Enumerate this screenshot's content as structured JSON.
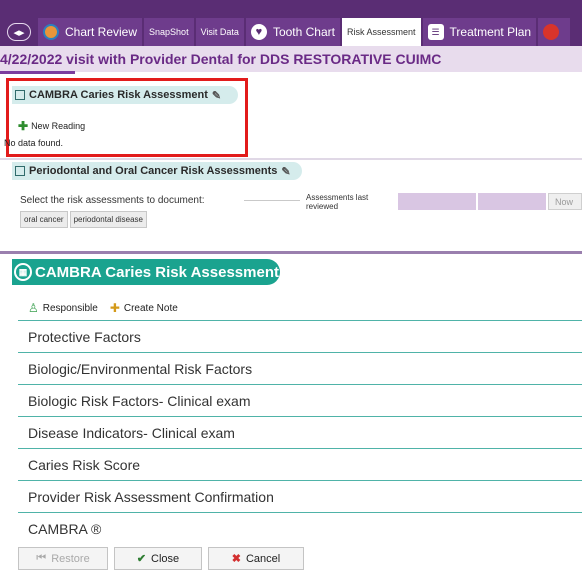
{
  "tabs": [
    {
      "label": "Chart Review",
      "icon": "chart-review-icon"
    },
    {
      "label": "SnapShot"
    },
    {
      "label": "Visit Data"
    },
    {
      "label": "Tooth Chart",
      "icon": "tooth-icon"
    },
    {
      "label": "Risk Assessment",
      "active": true
    },
    {
      "label": "Treatment Plan",
      "icon": "treatment-plan-icon"
    }
  ],
  "banner": {
    "title": "4/22/2022 visit with Provider Dental for DDS RESTORATIVE CUIMC"
  },
  "section_caries": {
    "title": "CAMBRA Caries Risk Assessment",
    "new_reading": "New Reading",
    "empty": "No data found."
  },
  "section_perio": {
    "title": "Periodontal and Oral Cancer Risk Assessments",
    "select_label": "Select the risk assessments to document:",
    "last_reviewed": "Assessments last reviewed",
    "now_button": "Now",
    "chips": [
      "oral cancer",
      "periodontal disease"
    ]
  },
  "cambra": {
    "title": "CAMBRA Caries Risk Assessment",
    "responsible": "Responsible",
    "create_note": "Create Note",
    "categories": [
      "Protective Factors",
      "Biologic/Environmental Risk Factors",
      "Biologic Risk Factors- Clinical exam",
      "Disease Indicators- Clinical exam",
      "Caries Risk Score",
      "Provider Risk Assessment Confirmation",
      "CAMBRA ®"
    ]
  },
  "buttons": {
    "restore": "Restore",
    "close": "Close",
    "cancel": "Cancel"
  },
  "colors": {
    "brand": "#5a2d74",
    "accent_teal": "#1aa38f",
    "highlight_red": "#e21b1b"
  }
}
